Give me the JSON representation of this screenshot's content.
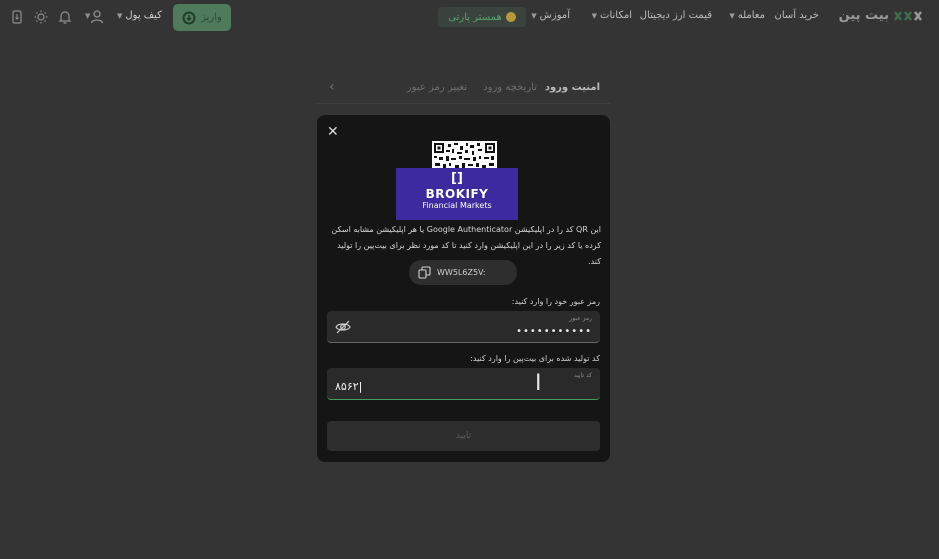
{
  "header": {
    "brand": "بیت پین",
    "nav": {
      "buy_easy": "خرید آسان",
      "trade": "معامله",
      "crypto_price": "قیمت ارز دیجیتال",
      "features": "امکانات",
      "education": "آموزش"
    },
    "partner": "همستر پارتی",
    "wallet": "کیف پول",
    "deposit": "واریز"
  },
  "tabs": {
    "security": "امنیت ورود",
    "login_history": "تاریخچه ورود",
    "change_password": "تغییر رمز عبور"
  },
  "modal": {
    "overlay_brand": "BROKIFY",
    "overlay_sub": "Financial Markets",
    "description": "این QR کد را در اپلیکیشن Google Authenticator یا هر اپلیکیشن مشابه اسکن کرده یا کد زیر را در این اپلیکیشن وارد کنید تا کد مورد نظر برای بیت‌پین را تولید کند.",
    "secret_code": "WW5L6Z5V:",
    "password_label": "رمز عبور خود را وارد کنید:",
    "password_mini": "رمز عبور",
    "password_value": "•••••••••••",
    "code_label": "کد تولید شده برای بیت‌پین را وارد کنید:",
    "code_mini": "کد تایید",
    "code_value": "۸۵۶۲",
    "submit": "تایید"
  },
  "colors": {
    "accent": "#3fa05f",
    "background": "#343434",
    "modal": "#151515"
  }
}
